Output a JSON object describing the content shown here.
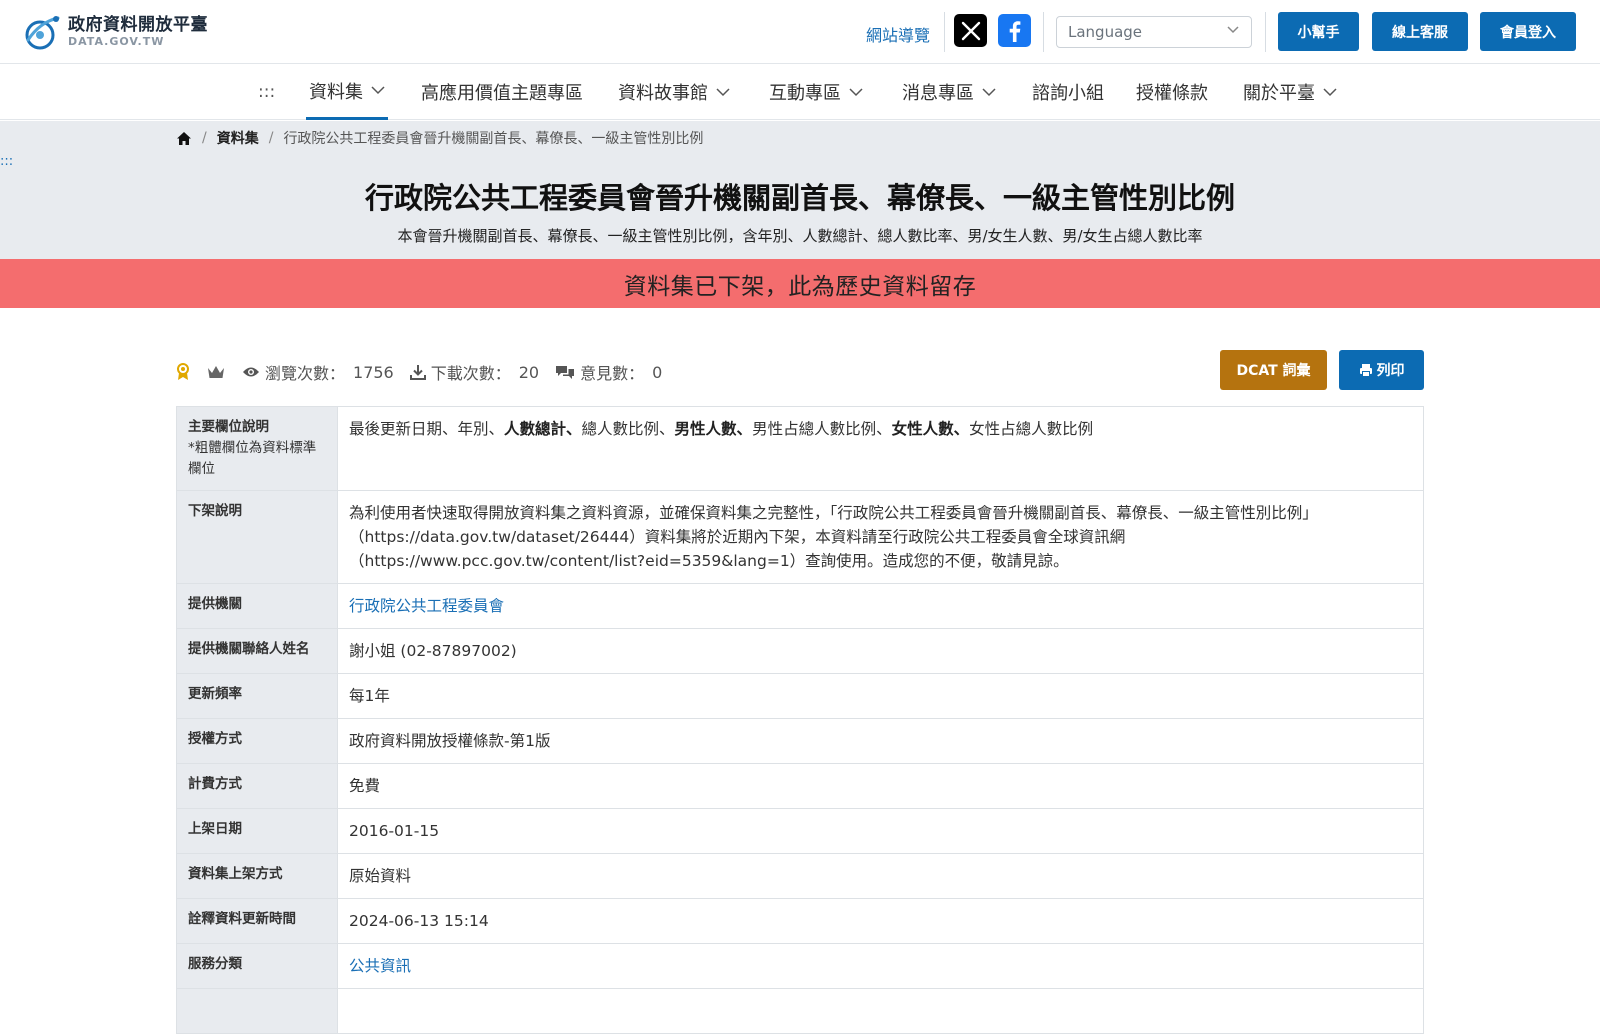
{
  "header": {
    "logo_zh": "政府資料開放平臺",
    "logo_en": "DATA.GOV.TW",
    "sitemap": "網站導覽",
    "language_placeholder": "Language",
    "buttons": {
      "helper": "小幫手",
      "service": "線上客服",
      "login": "會員登入"
    }
  },
  "nav": {
    "access_key": ":::",
    "items": [
      {
        "label": "資料集"
      },
      {
        "label": "高應用價值主題專區"
      },
      {
        "label": "資料故事館"
      },
      {
        "label": "互動專區"
      },
      {
        "label": "消息專區"
      },
      {
        "label": "諮詢小組"
      },
      {
        "label": "授權條款"
      },
      {
        "label": "關於平臺"
      }
    ]
  },
  "breadcrumb": {
    "level1": "資料集",
    "current": "行政院公共工程委員會晉升機關副首長、幕僚長、一級主管性別比例"
  },
  "hero": {
    "access_key": ":::",
    "title": "行政院公共工程委員會晉升機關副首長、幕僚長、一級主管性別比例",
    "subtitle": "本會晉升機關副首長、幕僚長、一級主管性別比例，含年別、人數總計、總人數比率、男/女生人數、男/女生占總人數比率",
    "notice": "資料集已下架，此為歷史資料留存"
  },
  "stats": {
    "views_label": "瀏覽次數：",
    "views": "1756",
    "downloads_label": "下載次數：",
    "downloads": "20",
    "comments_label": "意見數：",
    "comments": "0"
  },
  "actions": {
    "dcat": "DCAT 詞彙",
    "print": "列印"
  },
  "details": {
    "fields": {
      "key": "主要欄位說明",
      "note": "*粗體欄位為資料標準欄位",
      "parts": [
        "最後更新日期、年別、",
        "人數總計、",
        "總人數比例、",
        "男性人數、",
        "男性占總人數比例、",
        "女性人數、",
        "女性占總人數比例"
      ]
    },
    "removal": {
      "key": "下架說明",
      "value": "為利使用者快速取得開放資料集之資料資源，並確保資料集之完整性，「行政院公共工程委員會晉升機關副首長、幕僚長、一級主管性別比例」（https://data.gov.tw/dataset/26444）資料集將於近期內下架，本資料請至行政院公共工程委員會全球資訊網（https://www.pcc.gov.tw/content/list?eid=5359&lang=1）查詢使用。造成您的不便，敬請見諒。"
    },
    "provider": {
      "key": "提供機關",
      "value": "行政院公共工程委員會"
    },
    "contact": {
      "key": "提供機關聯絡人姓名",
      "value": "謝小姐 (02-87897002)"
    },
    "frequency": {
      "key": "更新頻率",
      "value": "每1年"
    },
    "license": {
      "key": "授權方式",
      "value": "政府資料開放授權條款-第1版"
    },
    "fee": {
      "key": "計費方式",
      "value": "免費"
    },
    "publish_date": {
      "key": "上架日期",
      "value": "2016-01-15"
    },
    "publish_method": {
      "key": "資料集上架方式",
      "value": "原始資料"
    },
    "meta_updated": {
      "key": "詮釋資料更新時間",
      "value": "2024-06-13 15:14"
    },
    "category": {
      "key": "服務分類",
      "value": "公共資訊"
    }
  },
  "colors": {
    "primary": "#0c6bb3",
    "dcat": "#b5730f",
    "notice": "#f46d6e",
    "hero_bg": "#e8ebef"
  }
}
